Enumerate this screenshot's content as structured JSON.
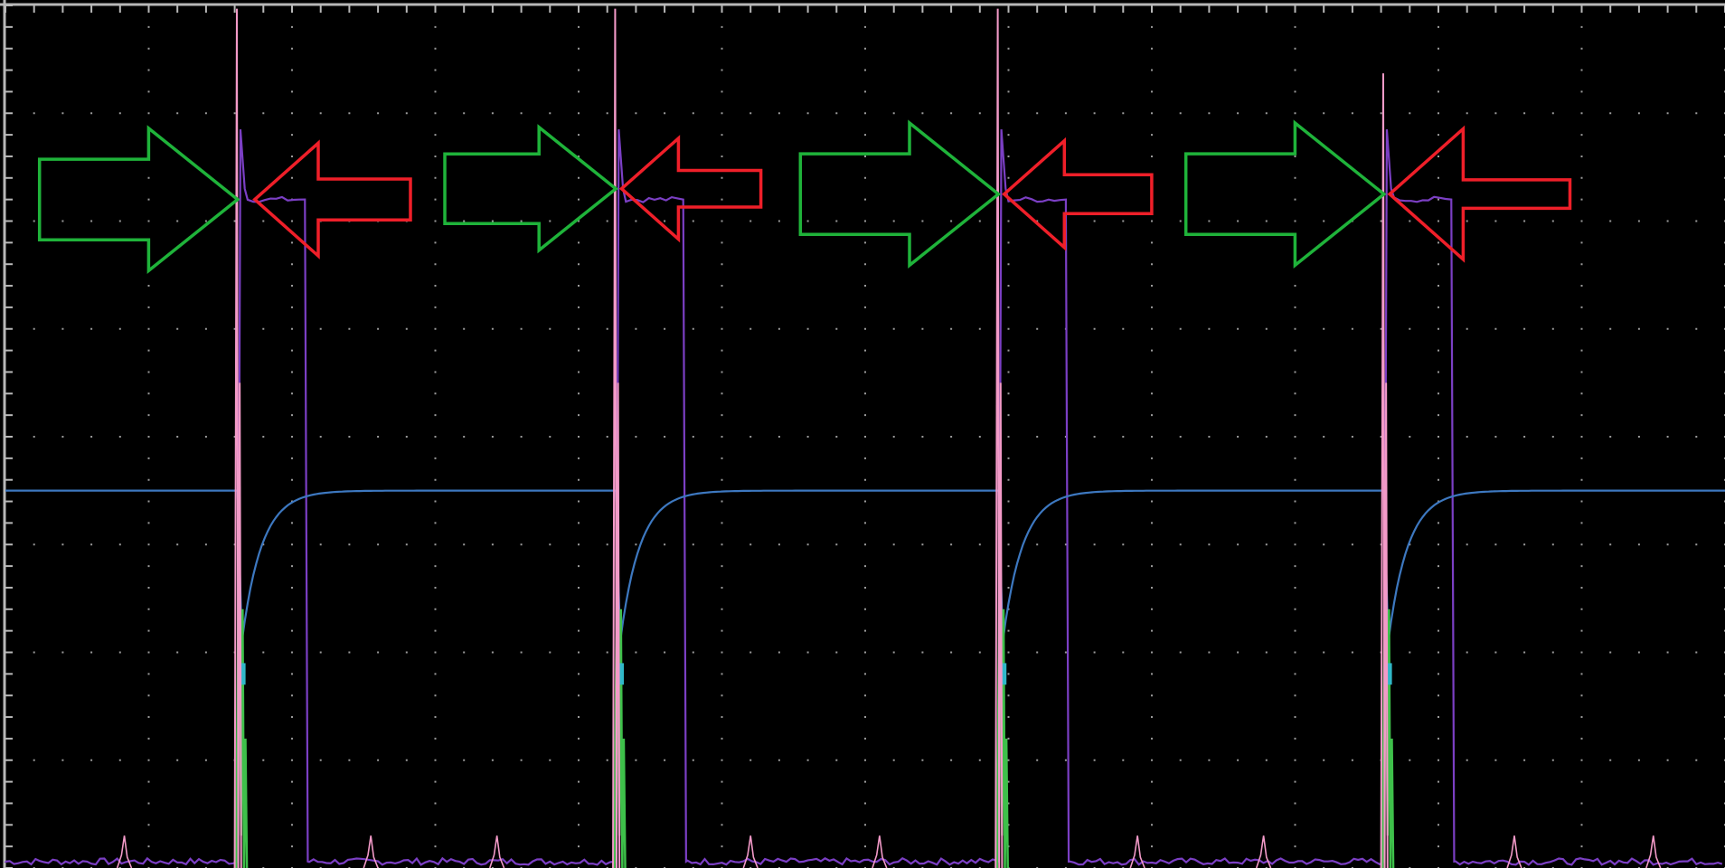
{
  "chart_data": {
    "type": "line",
    "title": "",
    "xlabel": "",
    "ylabel": "",
    "grid": true,
    "xlim": [
      0,
      12
    ],
    "ylim": [
      0,
      8
    ],
    "grid_divisions": {
      "x": 12,
      "y": 8
    },
    "sub_divisions": 5,
    "background": "#000000",
    "frame_color": "#b8b8b8",
    "grid_color": "#9a9a9a",
    "channel_colors": {
      "blue": "#3d78c0",
      "purple": "#7b3fc4",
      "pink": "#f39ac8",
      "green": "#3ec04a"
    },
    "annotation_colors": {
      "green_arrow": "#1fb33a",
      "red_arrow": "#ef1f29"
    },
    "pulse_start_x": [
      1.62,
      4.26,
      6.93,
      9.62
    ],
    "series": [
      {
        "color_key": "blue",
        "baseline": 3.5,
        "dip_min": 2.1,
        "settle_time": 0.55,
        "extent": "full"
      },
      {
        "color_key": "purple",
        "high": 6.2,
        "low": 0.06,
        "overshoot": 6.85,
        "width": 0.47,
        "extent": "full"
      },
      {
        "color_key": "pink",
        "spike_peak": 7.97,
        "spike_low": 0.0,
        "noise_bumps_x": [
          0.83,
          2.55,
          3.43,
          5.2,
          6.1,
          7.9,
          8.78,
          10.53,
          11.5
        ],
        "extent": "full"
      },
      {
        "color_key": "green",
        "spike_peak": 3.25,
        "spike_low": 0.0,
        "extent": "full"
      }
    ],
    "annotations": [
      {
        "pulse": 0,
        "green_tip": [
          1.62,
          6.2
        ],
        "green_size": 1.1,
        "red_tip": [
          1.74,
          6.2
        ],
        "red_size": 0.95
      },
      {
        "pulse": 1,
        "green_tip": [
          4.26,
          6.3
        ],
        "green_size": 0.95,
        "red_tip": [
          4.3,
          6.3
        ],
        "red_size": 0.85
      },
      {
        "pulse": 2,
        "green_tip": [
          6.93,
          6.25
        ],
        "green_size": 1.1,
        "red_tip": [
          6.97,
          6.25
        ],
        "red_size": 0.9
      },
      {
        "pulse": 3,
        "green_tip": [
          9.62,
          6.25
        ],
        "green_size": 1.1,
        "red_tip": [
          9.66,
          6.25
        ],
        "red_size": 1.1
      }
    ]
  }
}
